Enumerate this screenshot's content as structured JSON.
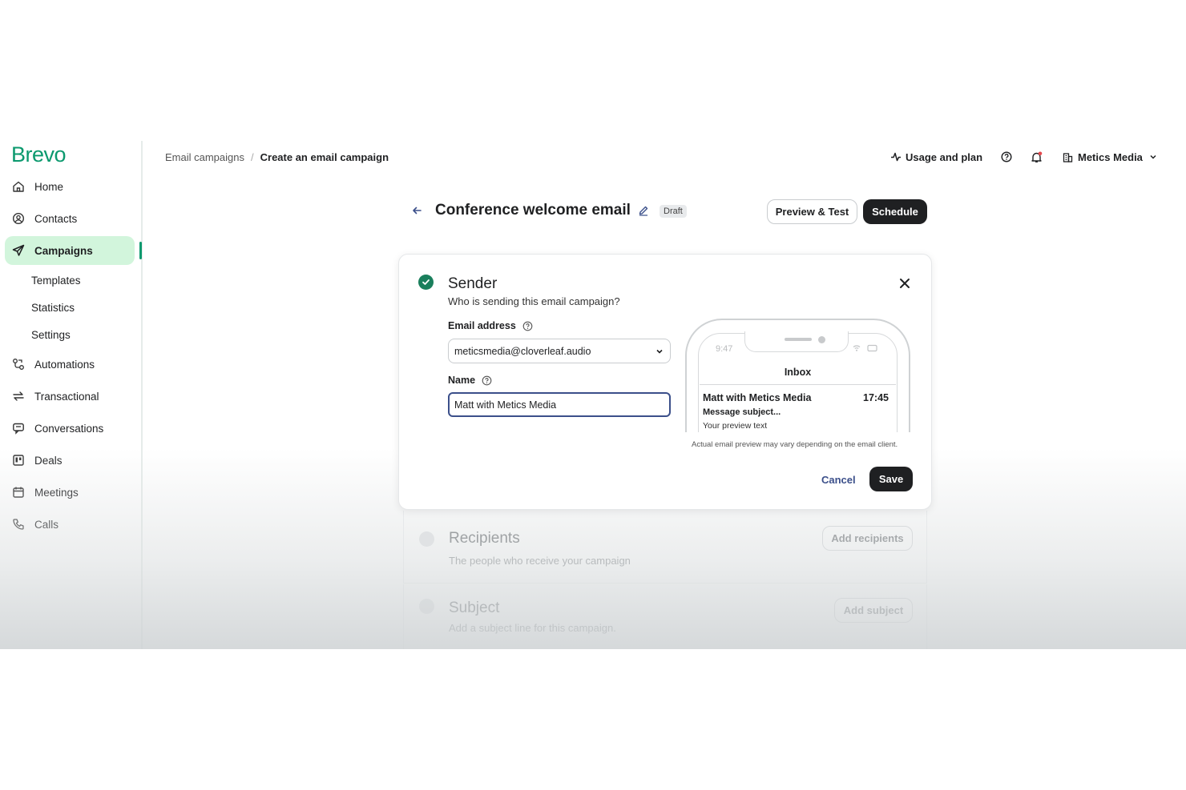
{
  "app": {
    "logo": "Brevo"
  },
  "sidebar": {
    "items": [
      {
        "label": "Home",
        "icon": "home-icon"
      },
      {
        "label": "Contacts",
        "icon": "contacts-icon"
      },
      {
        "label": "Campaigns",
        "icon": "send-icon",
        "active": true
      },
      {
        "label": "Automations",
        "icon": "automation-icon"
      },
      {
        "label": "Transactional",
        "icon": "transactional-icon"
      },
      {
        "label": "Conversations",
        "icon": "chat-icon"
      },
      {
        "label": "Deals",
        "icon": "deals-icon"
      },
      {
        "label": "Meetings",
        "icon": "calendar-icon"
      },
      {
        "label": "Calls",
        "icon": "phone-icon"
      }
    ],
    "subitems": [
      "Templates",
      "Statistics",
      "Settings"
    ]
  },
  "breadcrumb": {
    "parent": "Email campaigns",
    "separator": "/",
    "current": "Create an email campaign"
  },
  "topbar": {
    "usage": "Usage and plan",
    "account": "Metics Media"
  },
  "header": {
    "title": "Conference welcome email",
    "status": "Draft",
    "preview_label": "Preview & Test",
    "schedule_label": "Schedule"
  },
  "sender": {
    "title": "Sender",
    "subtitle": "Who is sending this email campaign?",
    "email_label": "Email address",
    "email_value": "meticsmedia@cloverleaf.audio",
    "name_label": "Name",
    "name_value": "Matt with Metics Media",
    "cancel_label": "Cancel",
    "save_label": "Save"
  },
  "preview": {
    "time": "9:47",
    "inbox": "Inbox",
    "from": "Matt with Metics Media",
    "mail_time": "17:45",
    "subject": "Message subject...",
    "preview_text": "Your preview text",
    "note": "Actual email preview may vary depending on the email client."
  },
  "steps": {
    "recipients": {
      "title": "Recipients",
      "subtitle": "The people who receive your campaign",
      "button": "Add recipients"
    },
    "subject": {
      "title": "Subject",
      "subtitle": "Add a subject line for this campaign.",
      "button": "Add subject"
    }
  },
  "colors": {
    "brand": "#0b996e",
    "active_bg": "#d2f5dc",
    "dark_button": "#1f2022",
    "link": "#3b4f8a"
  }
}
